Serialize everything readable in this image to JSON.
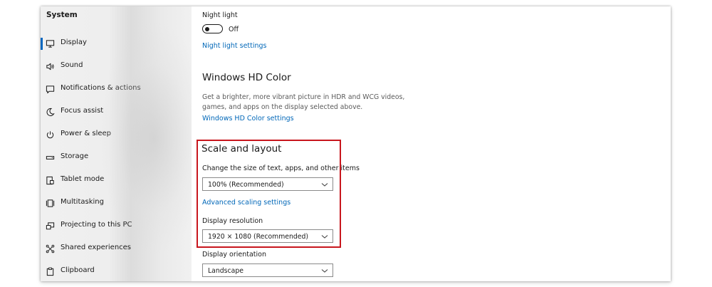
{
  "sidebar": {
    "title": "System",
    "items": [
      {
        "label": "Display",
        "icon": "monitor-icon",
        "selected": true
      },
      {
        "label": "Sound",
        "icon": "speaker-icon"
      },
      {
        "label": "Notifications & actions",
        "icon": "notification-icon"
      },
      {
        "label": "Focus assist",
        "icon": "moon-icon"
      },
      {
        "label": "Power & sleep",
        "icon": "power-icon"
      },
      {
        "label": "Storage",
        "icon": "storage-icon"
      },
      {
        "label": "Tablet mode",
        "icon": "tablet-icon"
      },
      {
        "label": "Multitasking",
        "icon": "multitasking-icon"
      },
      {
        "label": "Projecting to this PC",
        "icon": "projecting-icon"
      },
      {
        "label": "Shared experiences",
        "icon": "shared-icon"
      },
      {
        "label": "Clipboard",
        "icon": "clipboard-icon"
      }
    ]
  },
  "night_light": {
    "label": "Night light",
    "toggle_state": "Off",
    "settings_link": "Night light settings"
  },
  "hd_color": {
    "heading": "Windows HD Color",
    "description": "Get a brighter, more vibrant picture in HDR and WCG videos, games, and apps on the display selected above.",
    "settings_link": "Windows HD Color settings"
  },
  "scale_layout": {
    "heading": "Scale and layout",
    "scale_label": "Change the size of text, apps, and other items",
    "scale_value": "100% (Recommended)",
    "advanced_link": "Advanced scaling settings",
    "resolution_label": "Display resolution",
    "resolution_value": "1920 × 1080 (Recommended)",
    "orientation_label": "Display orientation",
    "orientation_value": "Landscape"
  },
  "colors": {
    "accent": "#0067c0",
    "link": "#0067b8",
    "highlight": "#c8161d"
  }
}
